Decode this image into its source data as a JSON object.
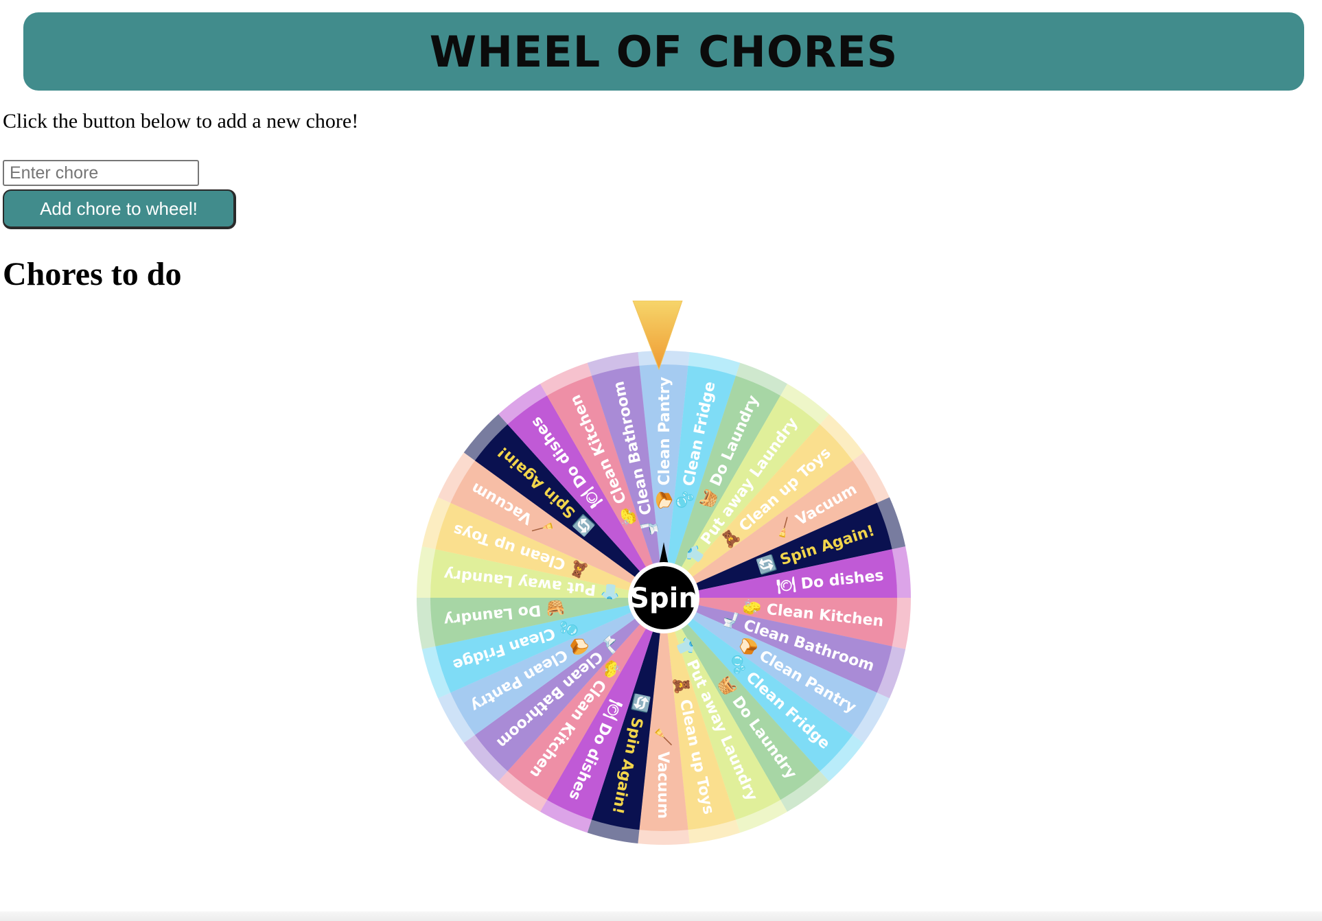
{
  "header": {
    "title": "WHEEL OF CHORES"
  },
  "instructions": "Click the button below to add a new chore!",
  "chore_input": {
    "value": "",
    "placeholder": "Enter chore"
  },
  "add_button": {
    "label": "Add chore to wheel!"
  },
  "chores_section": {
    "title": "Chores to do"
  },
  "wheel": {
    "spin_label": "Spin",
    "segments": [
      {
        "label": "Clean Pantry",
        "color": "#a5cbf1",
        "text_color": "#ffffff",
        "icon": "🍞"
      },
      {
        "label": "Clean Fridge",
        "color": "#7fdcf6",
        "text_color": "#ffffff",
        "icon": "🫧"
      },
      {
        "label": "Do Laundry",
        "color": "#a7d6a5",
        "text_color": "#ffffff",
        "icon": "🧺"
      },
      {
        "label": "Put away Laundry",
        "color": "#e0ef9a",
        "text_color": "#ffffff",
        "icon": "👕"
      },
      {
        "label": "Clean up Toys",
        "color": "#fadf8e",
        "text_color": "#ffffff",
        "icon": "🧸"
      },
      {
        "label": "Vacuum",
        "color": "#f7bea6",
        "text_color": "#ffffff",
        "icon": "🧹"
      },
      {
        "label": "Spin Again!",
        "color": "#0a1150",
        "text_color": "#f2d54b",
        "icon": "🔄"
      },
      {
        "label": "Do dishes",
        "color": "#c05ad6",
        "text_color": "#ffffff",
        "icon": "🍽"
      },
      {
        "label": "Clean Kitchen",
        "color": "#ee8fa6",
        "text_color": "#ffffff",
        "icon": "🧽"
      },
      {
        "label": "Clean Bathroom",
        "color": "#a98bd6",
        "text_color": "#ffffff",
        "icon": "🚽"
      },
      {
        "label": "Clean Pantry",
        "color": "#a5cbf1",
        "text_color": "#ffffff",
        "icon": "🍞"
      },
      {
        "label": "Clean Fridge",
        "color": "#7fdcf6",
        "text_color": "#ffffff",
        "icon": "🫧"
      },
      {
        "label": "Do Laundry",
        "color": "#a7d6a5",
        "text_color": "#ffffff",
        "icon": "🧺"
      },
      {
        "label": "Put away Laundry",
        "color": "#e0ef9a",
        "text_color": "#ffffff",
        "icon": "👕"
      },
      {
        "label": "Clean up Toys",
        "color": "#fadf8e",
        "text_color": "#ffffff",
        "icon": "🧸"
      },
      {
        "label": "Vacuum",
        "color": "#f7bea6",
        "text_color": "#ffffff",
        "icon": "🧹"
      },
      {
        "label": "Spin Again!",
        "color": "#0a1150",
        "text_color": "#f2d54b",
        "icon": "🔄"
      },
      {
        "label": "Do dishes",
        "color": "#c05ad6",
        "text_color": "#ffffff",
        "icon": "🍽"
      },
      {
        "label": "Clean Kitchen",
        "color": "#ee8fa6",
        "text_color": "#ffffff",
        "icon": "🧽"
      },
      {
        "label": "Clean Bathroom",
        "color": "#a98bd6",
        "text_color": "#ffffff",
        "icon": "🚽"
      },
      {
        "label": "Clean Pantry",
        "color": "#a5cbf1",
        "text_color": "#ffffff",
        "icon": "🍞"
      },
      {
        "label": "Clean Fridge",
        "color": "#7fdcf6",
        "text_color": "#ffffff",
        "icon": "🫧"
      },
      {
        "label": "Do Laundry",
        "color": "#a7d6a5",
        "text_color": "#ffffff",
        "icon": "🧺"
      },
      {
        "label": "Put away Laundry",
        "color": "#e0ef9a",
        "text_color": "#ffffff",
        "icon": "👕"
      },
      {
        "label": "Clean up Toys",
        "color": "#fadf8e",
        "text_color": "#ffffff",
        "icon": "🧸"
      },
      {
        "label": "Vacuum",
        "color": "#f7bea6",
        "text_color": "#ffffff",
        "icon": "🧹"
      },
      {
        "label": "Spin Again!",
        "color": "#0a1150",
        "text_color": "#f2d54b",
        "icon": "🔄"
      },
      {
        "label": "Do dishes",
        "color": "#c05ad6",
        "text_color": "#ffffff",
        "icon": "🍽"
      },
      {
        "label": "Clean Kitchen",
        "color": "#ee8fa6",
        "text_color": "#ffffff",
        "icon": "🧽"
      },
      {
        "label": "Clean Bathroom",
        "color": "#a98bd6",
        "text_color": "#ffffff",
        "icon": "🚽"
      }
    ]
  }
}
